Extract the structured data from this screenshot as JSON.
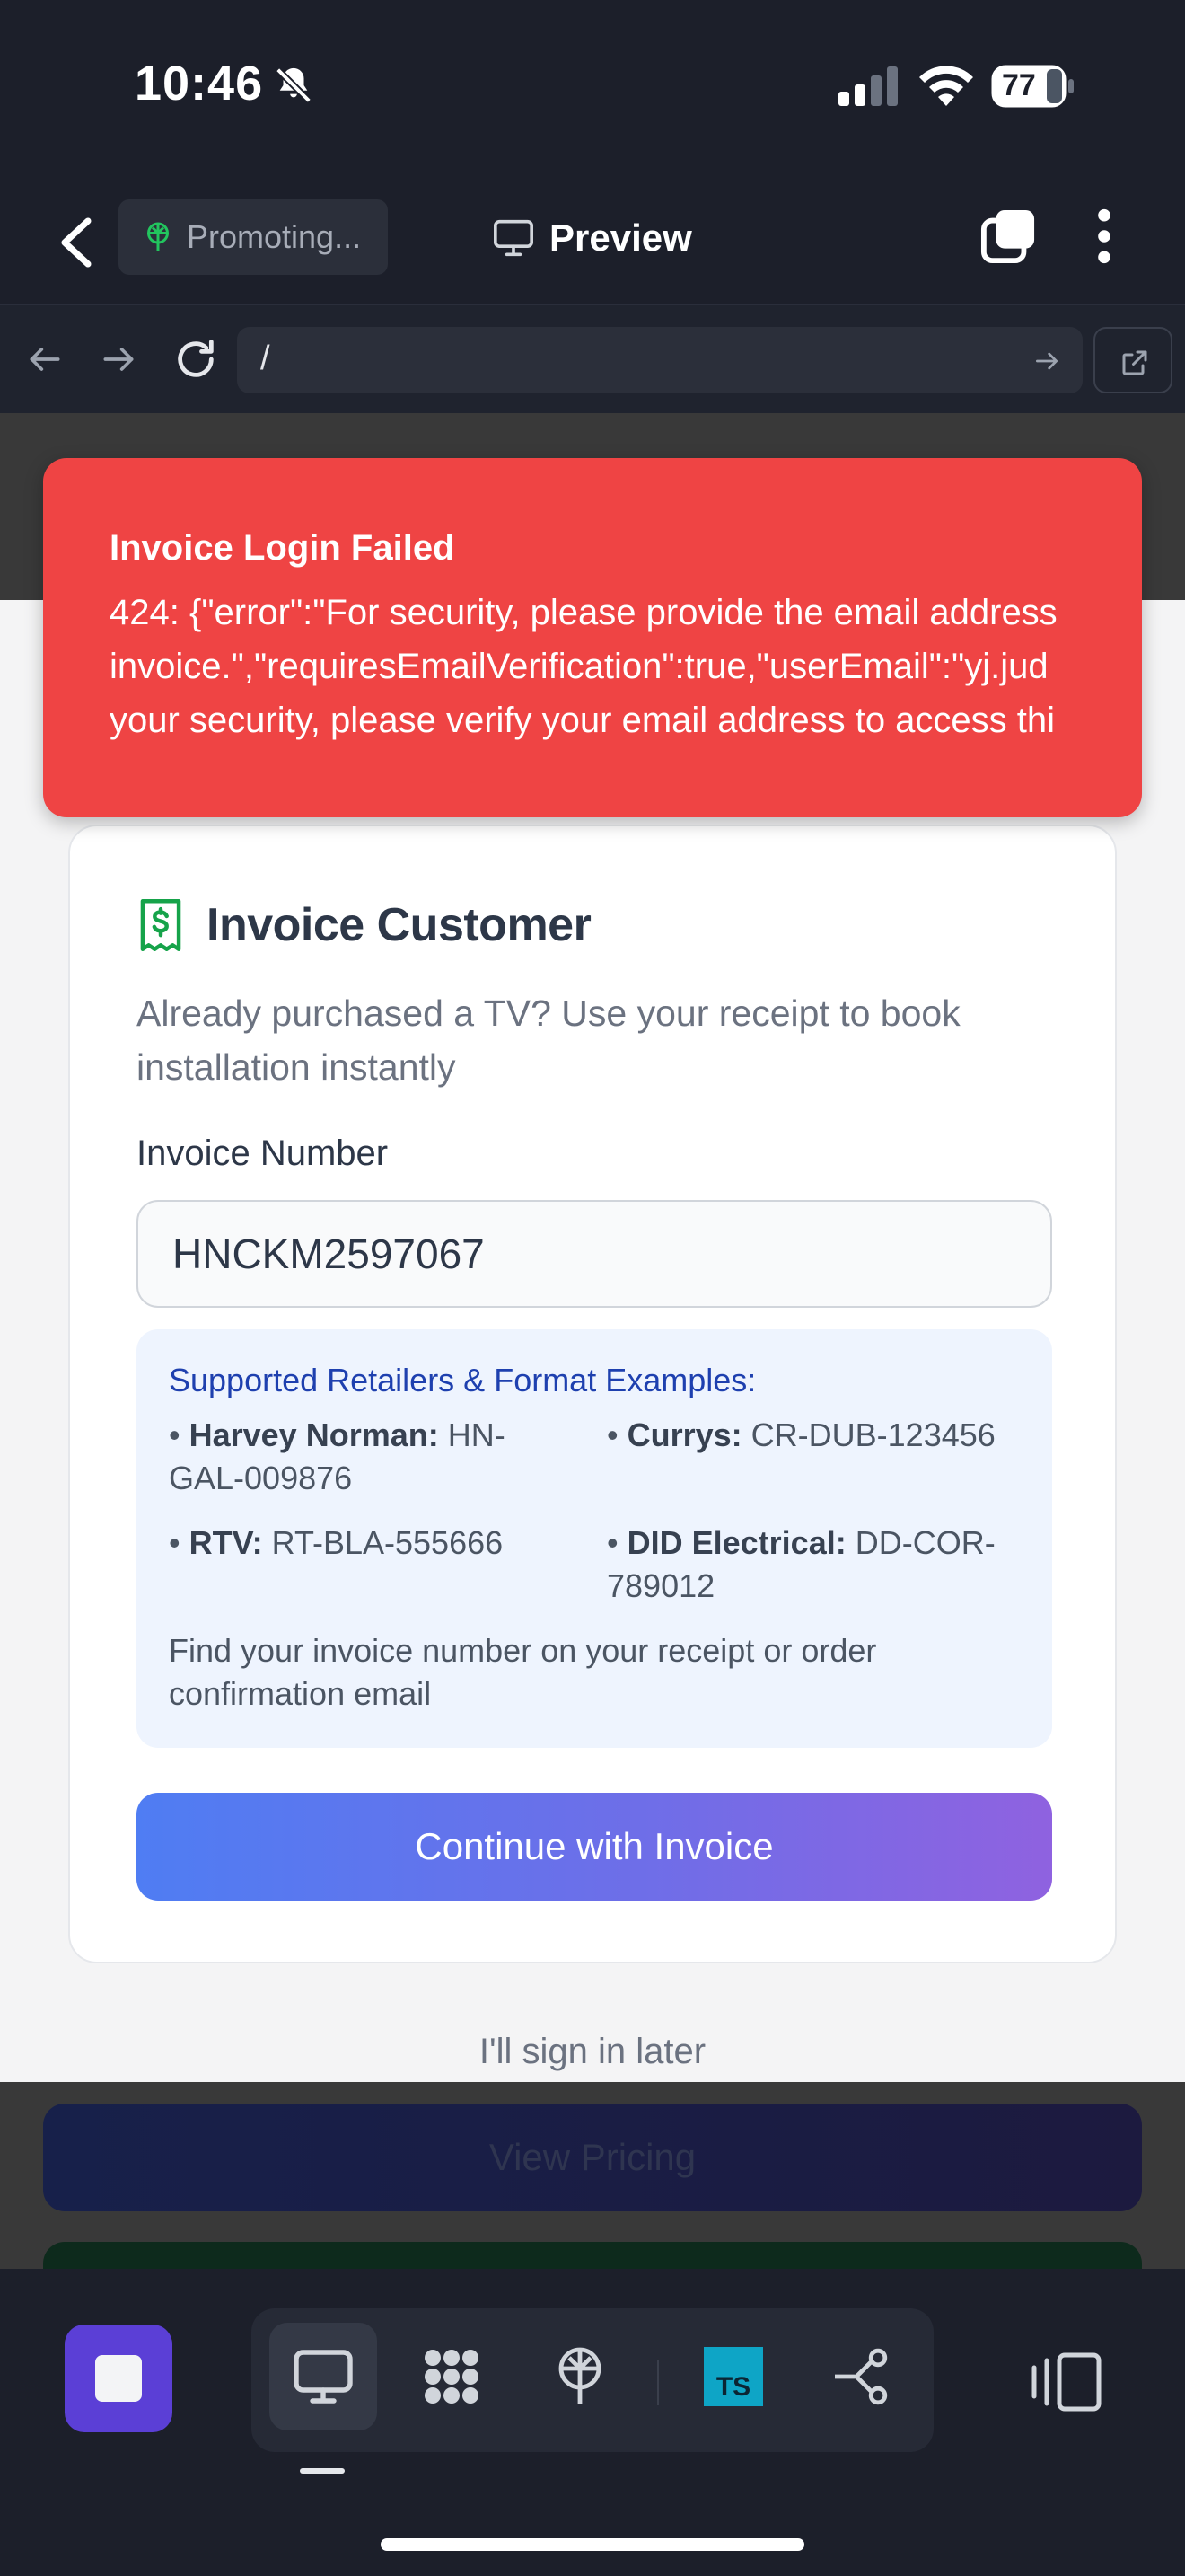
{
  "status_bar": {
    "time": "10:46",
    "battery": "77"
  },
  "header": {
    "project_chip": "Promoting...",
    "title": "Preview"
  },
  "browser": {
    "url": "/"
  },
  "toast": {
    "title": "Invoice Login Failed",
    "message": "424: {\"error\":\"For security, please provide the email address\ninvoice.\",\"requiresEmailVerification\":true,\"userEmail\":\"yj.jud\nyour security, please verify your email address to access thi"
  },
  "card": {
    "title": "Invoice Customer",
    "subtitle": "Already purchased a TV? Use your receipt to book installation instantly",
    "field_label": "Invoice Number",
    "invoice_value": "HNCKM2597067",
    "info_title": "Supported Retailers & Format Examples:",
    "retailers": [
      {
        "name": "Harvey Norman:",
        "format": "HN-GAL-009876"
      },
      {
        "name": "Currys:",
        "format": "CR-DUB-123456"
      },
      {
        "name": "RTV:",
        "format": "RT-BLA-555666"
      },
      {
        "name": "DID Electrical:",
        "format": "DD-COR-789012"
      }
    ],
    "info_note": "Find your invoice number on your receipt or order confirmation email",
    "continue_label": "Continue with Invoice"
  },
  "sign_later": "I'll sign in later",
  "pricing_label": "View Pricing",
  "toolbar": {
    "tools": [
      "desktop-icon",
      "apps-grid-icon",
      "deploy-icon",
      "typescript-icon",
      "git-branch-icon"
    ],
    "ts_label": "TS"
  },
  "colors": {
    "toast": "#ef4444",
    "button_start": "#4f7df3",
    "button_end": "#8f62e0",
    "stop_button": "#5b3fd6"
  }
}
